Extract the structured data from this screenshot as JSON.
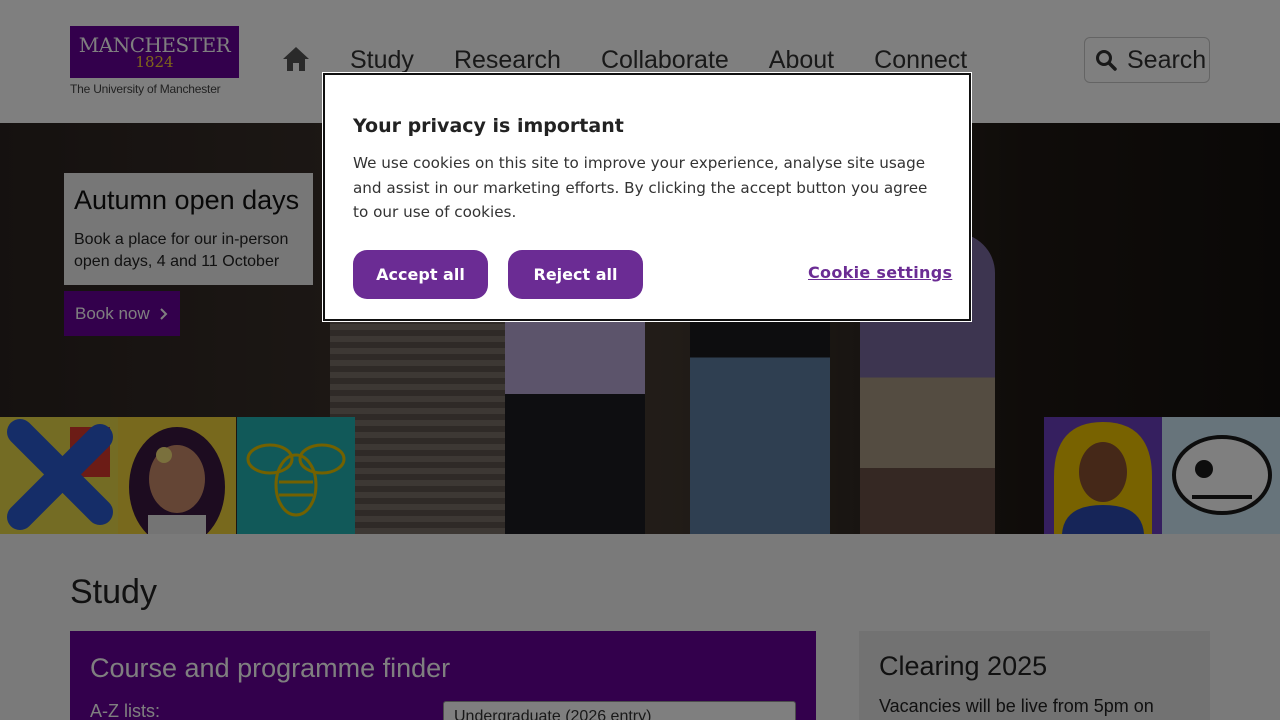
{
  "header": {
    "logo": {
      "line1": "MANCHESTER",
      "line2": "1824",
      "subtitle": "The University of Manchester"
    },
    "nav": [
      "Study",
      "Research",
      "Collaborate",
      "About",
      "Connect"
    ],
    "search_label": "Search"
  },
  "hero": {
    "promo_title": "Autumn open days",
    "promo_text": "Book a place for our in-person open days, 4 and 11 October",
    "promo_button": "Book now"
  },
  "study": {
    "heading": "Study",
    "finder": {
      "title": "Course and programme finder",
      "label": "A-Z lists:",
      "selected": "Undergraduate (2026 entry)"
    },
    "clearing": {
      "title": "Clearing 2025",
      "text": "Vacancies will be live from 5pm on"
    }
  },
  "cookie_modal": {
    "title": "Your privacy is important",
    "body": "We use cookies on this site to improve your experience, analyse site usage and assist in our marketing efforts. By clicking the accept button you agree to our use of cookies.",
    "accept_label": "Accept all",
    "reject_label": "Reject all",
    "settings_label": "Cookie settings"
  },
  "colors": {
    "brand_purple": "#660099",
    "button_purple": "#6b2c94",
    "logo_gold": "#ffcc33"
  },
  "icons": {
    "home": "home-icon",
    "search": "search-icon",
    "chevron": "chevron-right-icon"
  }
}
